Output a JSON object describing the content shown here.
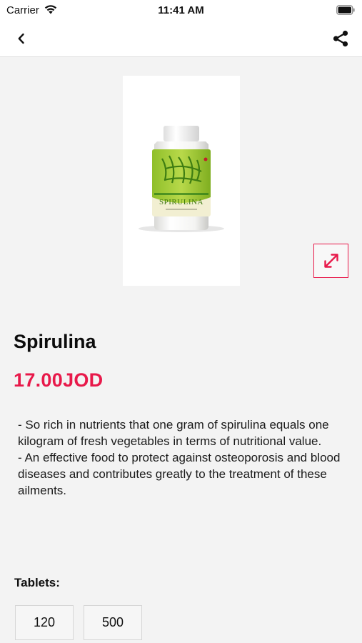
{
  "status_bar": {
    "carrier": "Carrier",
    "time": "11:41 AM",
    "wifi_icon": "wifi-icon",
    "battery_icon": "battery-icon"
  },
  "nav": {
    "back_icon": "chevron-left-icon",
    "share_icon": "share-icon"
  },
  "product": {
    "image_label": "SPIRULINA",
    "expand_icon": "expand-arrows-icon",
    "title": "Spirulina",
    "price": "17.00JOD",
    "description": [
      "- So rich in nutrients that one gram of spirulina equals one kilogram of fresh vegetables in terms of nutritional value.",
      "- An effective food to protect against osteoporosis and blood diseases and contributes greatly to the treatment of these ailments."
    ]
  },
  "options": {
    "label": "Tablets:",
    "values": [
      "120",
      "500"
    ]
  },
  "colors": {
    "accent": "#e8194a",
    "background": "#f3f3f3"
  }
}
